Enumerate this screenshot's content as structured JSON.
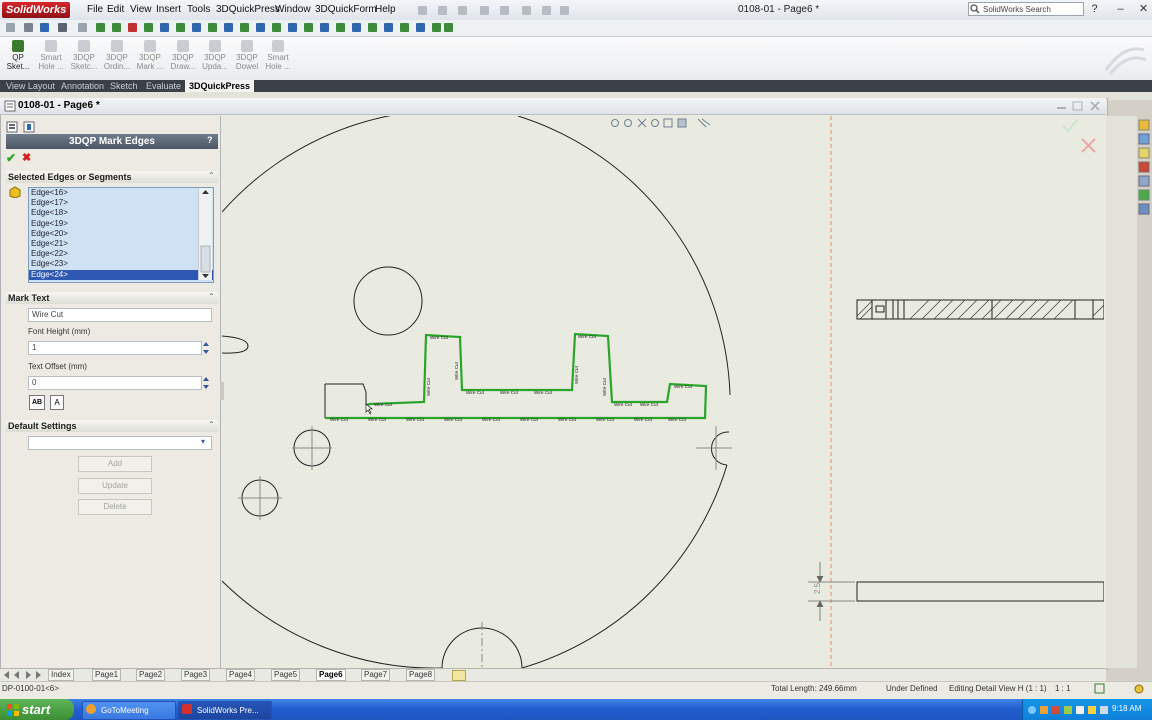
{
  "app": {
    "logo_text": "SolidWorks",
    "menu": [
      "File",
      "Edit",
      "View",
      "Insert",
      "Tools",
      "3DQuickPress",
      "Window",
      "3DQuickForm",
      "Help"
    ],
    "document_title": "0108-01 - Page6 *",
    "search_placeholder": "SolidWorks Search",
    "window_buttons": [
      "?",
      "–",
      "✕"
    ]
  },
  "command_manager": {
    "buttons": [
      {
        "label": "QP Sket...",
        "enabled": true
      },
      {
        "label": "Smart Hole ...",
        "enabled": false
      },
      {
        "label": "3DQP Sketc...",
        "enabled": false
      },
      {
        "label": "3DQP Ordin...",
        "enabled": false
      },
      {
        "label": "3DQP Mark ...",
        "enabled": false
      },
      {
        "label": "3DQP Draw...",
        "enabled": false
      },
      {
        "label": "3DQP Upda...",
        "enabled": false
      },
      {
        "label": "3DQP Dowel",
        "enabled": false
      },
      {
        "label": "Smart Hole ...",
        "enabled": false
      }
    ],
    "tabs": [
      "View Layout",
      "Annotation",
      "Sketch",
      "Evaluate",
      "3DQuickPress"
    ],
    "active_tab": "3DQuickPress"
  },
  "document": {
    "caption": "0108-01 - Page6 *"
  },
  "property_manager": {
    "title": "3DQP Mark Edges",
    "help": "?",
    "ok_symbol": "✔",
    "cancel_symbol": "✖",
    "selected_group": {
      "title": "Selected Edges or Segments",
      "edges": [
        "Edge<16>",
        "Edge<17>",
        "Edge<18>",
        "Edge<19>",
        "Edge<20>",
        "Edge<21>",
        "Edge<22>",
        "Edge<23>",
        "Edge<24>"
      ],
      "selected": "Edge<24>"
    },
    "mark_text_group": {
      "title": "Mark Text",
      "text_value": "Wire Cut",
      "font_height_label": "Font Height (mm)",
      "font_height_value": "1",
      "text_offset_label": "Text Offset (mm)",
      "text_offset_value": "0",
      "btn_ab": "AB",
      "btn_a": "A"
    },
    "default_group": {
      "title": "Default Settings",
      "select_value": "",
      "add": "Add",
      "update": "Update",
      "delete": "Delete"
    }
  },
  "drawing": {
    "dimension_label": "2.5",
    "mark_text": "Wire Cut"
  },
  "sheets": [
    "Index",
    "Page1",
    "Page2",
    "Page3",
    "Page4",
    "Page5",
    "Page6",
    "Page7",
    "Page8"
  ],
  "active_sheet": "Page6",
  "status": {
    "left": "DP-0100-01<6>",
    "total_length": "Total Length: 249.66mm",
    "state": "Under Defined",
    "editing": "Editing Detail View H (1 : 1)",
    "scale": "1 : 1"
  },
  "taskbar": {
    "start": "start",
    "items": [
      "GoToMeeting",
      "SolidWorks Pre..."
    ],
    "clock": "9:18 AM"
  },
  "colors": {
    "accent_green": "#2aa52a",
    "selection_blue": "#2f58b3",
    "list_bg": "#cfe2f4",
    "canvas_bg": "#e9ebe0"
  }
}
